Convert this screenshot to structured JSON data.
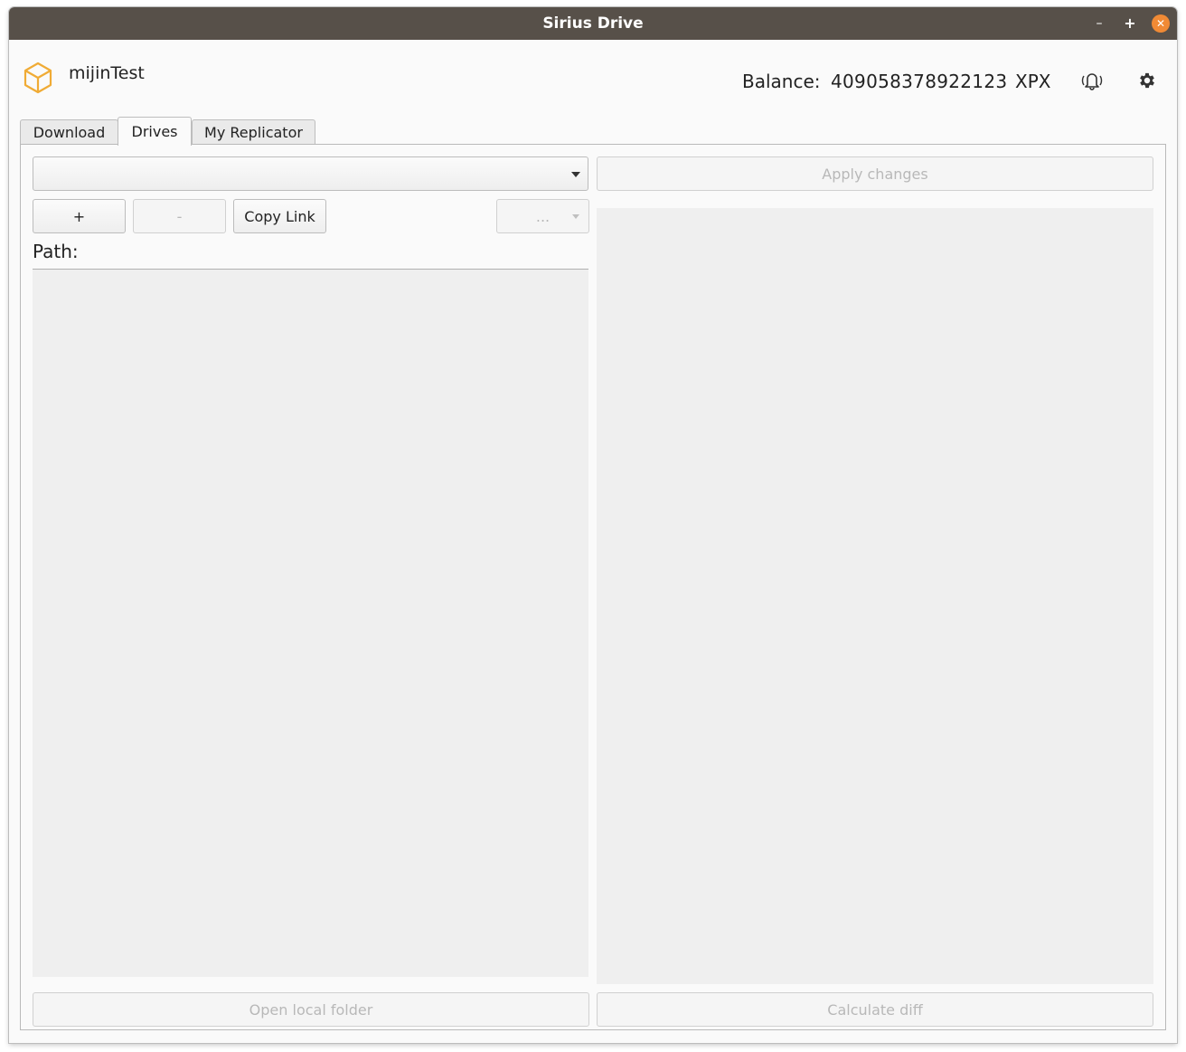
{
  "window": {
    "title": "Sirius Drive",
    "controls": {
      "minimize": "–",
      "maximize": "+",
      "close": "✕"
    }
  },
  "header": {
    "username": "mijinTest",
    "balance_label": "Balance:",
    "balance_value": "409058378922123",
    "balance_unit": "XPX",
    "icons": [
      "package-icon",
      "bell-icon",
      "gear-icon"
    ],
    "accent_color": "#f0ab35"
  },
  "tabs": [
    {
      "label": "Download",
      "active": false
    },
    {
      "label": "Drives",
      "active": true
    },
    {
      "label": "My Replicator",
      "active": false
    }
  ],
  "drives": {
    "drive_select_value": "",
    "apply_label": "Apply changes",
    "add_label": "+",
    "remove_label": "-",
    "copy_link_label": "Copy Link",
    "more_label": "...",
    "path_label": "Path:",
    "open_local_label": "Open local folder",
    "calc_diff_label": "Calculate diff"
  }
}
